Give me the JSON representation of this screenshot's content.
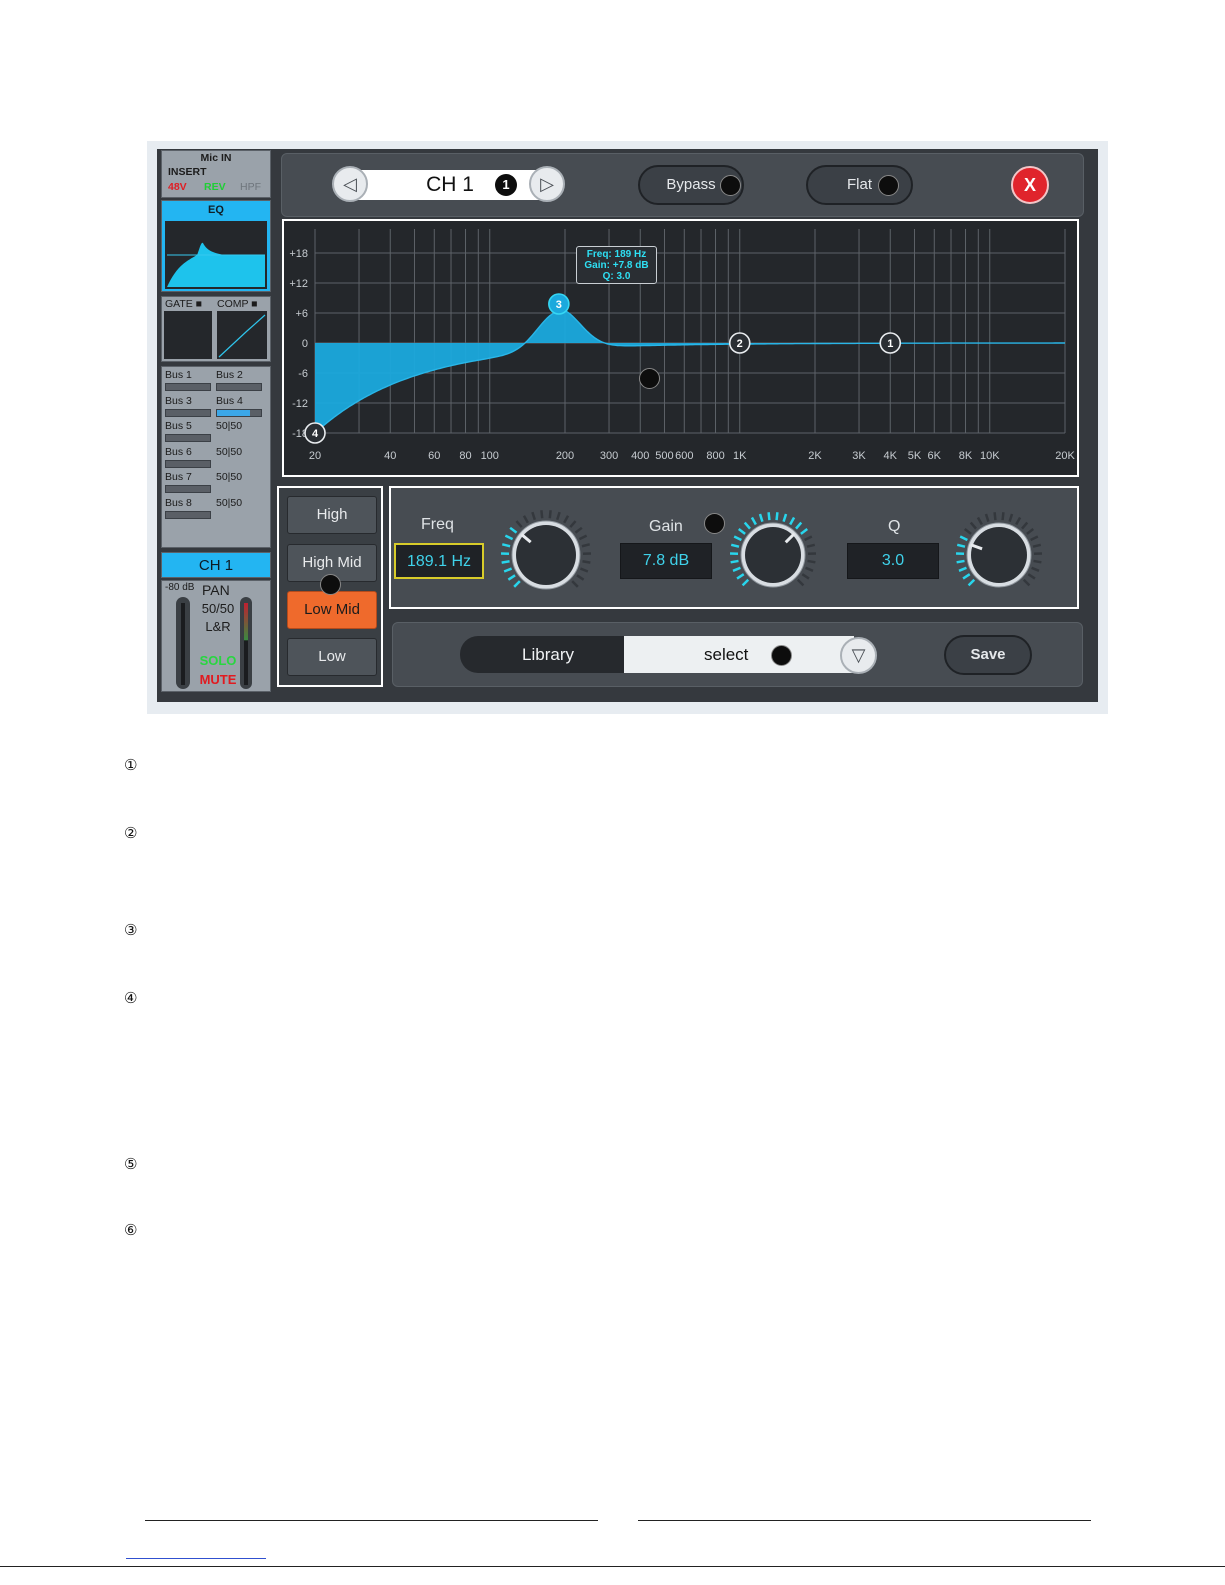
{
  "sidebar": {
    "input": {
      "title": "Mic IN",
      "insert": "INSERT",
      "phantom": "48V",
      "rev": "REV",
      "hpf": "HPF"
    },
    "eq_label": "EQ",
    "gate_label": "GATE ■",
    "comp_label": "COMP ■",
    "buses": [
      {
        "name": "Bus 1",
        "level": 0
      },
      {
        "name": "Bus 2",
        "level": 0
      },
      {
        "name": "Bus 3",
        "level": 0
      },
      {
        "name": "Bus 4",
        "level": 0.75
      },
      {
        "name": "Bus 5",
        "level": 0
      },
      {
        "name": "Bus 6",
        "level": 0
      },
      {
        "name": "Bus 7",
        "level": 0
      },
      {
        "name": "Bus 8",
        "level": 0
      }
    ],
    "bus_pan": [
      "50|50",
      "50|50",
      "50|50",
      "50|50"
    ],
    "channel_name": "CH 1",
    "fader": {
      "db": "-80 dB",
      "pan_label": "PAN",
      "pan_value": "50/50",
      "routing": "L&R",
      "solo": "SOLO",
      "mute": "MUTE"
    }
  },
  "toolbar": {
    "prev_icon": "◁",
    "channel": "CH 1",
    "next_icon": "▷",
    "bypass": "Bypass",
    "flat": "Flat",
    "close": "X",
    "callout_1": "1"
  },
  "eq_graph": {
    "y_ticks": [
      "+18",
      "+12",
      "+6",
      "0",
      "-6",
      "-12",
      "-18"
    ],
    "x_ticks": [
      "20",
      "40",
      "60",
      "80",
      "100",
      "200",
      "300",
      "400",
      "500",
      "600",
      "800",
      "1K",
      "2K",
      "3K",
      "4K",
      "5K",
      "6K",
      "8K",
      "10K",
      "20K"
    ],
    "tooltip": {
      "freq": "Freq: 189 Hz",
      "gain": "Gain: +7.8 dB",
      "q": "Q: 3.0"
    },
    "bands": [
      {
        "label": "1",
        "freq_hz": 4000,
        "gain_db": 0
      },
      {
        "label": "2",
        "freq_hz": 1000,
        "gain_db": 0
      },
      {
        "label": "3",
        "freq_hz": 189,
        "gain_db": 7.8
      },
      {
        "label": "4",
        "freq_hz": 20,
        "gain_db": -18
      }
    ],
    "colors": {
      "fill": "#1ba9dd",
      "line": "#29b6e8"
    }
  },
  "band_select": {
    "items": [
      "High",
      "High Mid",
      "Low Mid",
      "Low"
    ],
    "active": "Low Mid"
  },
  "params": {
    "freq": {
      "label": "Freq",
      "value": "189.1 Hz"
    },
    "gain": {
      "label": "Gain",
      "value": "7.8 dB"
    },
    "q": {
      "label": "Q",
      "value": "3.0"
    }
  },
  "library": {
    "label": "Library",
    "select": "select",
    "dropdown_icon": "▽",
    "save": "Save"
  },
  "notes": [
    "①",
    "②",
    "③",
    "④",
    "⑤",
    "⑥"
  ]
}
